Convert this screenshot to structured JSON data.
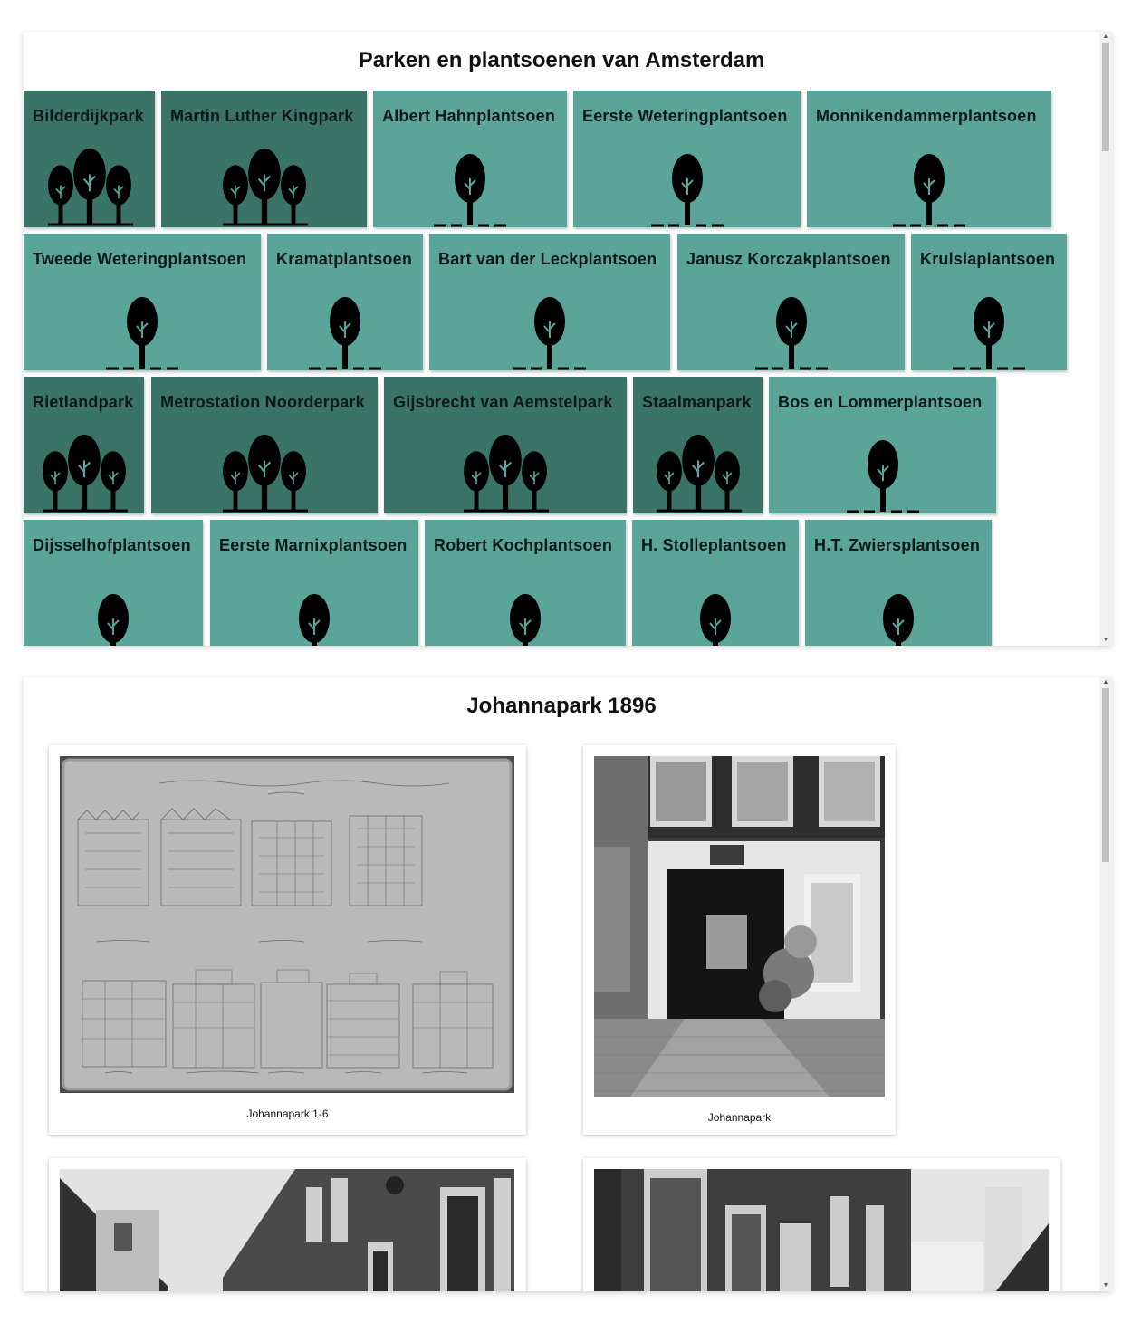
{
  "parks_panel": {
    "title": "Parken en plantsoenen van Amsterdam",
    "tiles": [
      {
        "name": "Bilderdijkpark",
        "kind": "park"
      },
      {
        "name": "Martin Luther Kingpark",
        "kind": "park"
      },
      {
        "name": "Albert Hahnplantsoen",
        "kind": "plantsoen"
      },
      {
        "name": "Eerste Weteringplantsoen",
        "kind": "plantsoen"
      },
      {
        "name": "Monnikendammerplantsoen",
        "kind": "plantsoen"
      },
      {
        "name": "Tweede Weteringplantsoen",
        "kind": "plantsoen"
      },
      {
        "name": "Kramatplantsoen",
        "kind": "plantsoen"
      },
      {
        "name": "Bart van der Leckplantsoen",
        "kind": "plantsoen"
      },
      {
        "name": "Janusz Korczakplantsoen",
        "kind": "plantsoen"
      },
      {
        "name": "Krulslaplantsoen",
        "kind": "plantsoen"
      },
      {
        "name": "Rietlandpark",
        "kind": "park"
      },
      {
        "name": "Metrostation Noorderpark",
        "kind": "park"
      },
      {
        "name": "Gijsbrecht van Aemstelpark",
        "kind": "park"
      },
      {
        "name": "Staalmanpark",
        "kind": "park"
      },
      {
        "name": "Bos en Lommerplantsoen",
        "kind": "plantsoen"
      },
      {
        "name": "Dijsselhofplantsoen",
        "kind": "plantsoen"
      },
      {
        "name": "Eerste Marnixplantsoen",
        "kind": "plantsoen"
      },
      {
        "name": "Robert Kochplantsoen",
        "kind": "plantsoen"
      },
      {
        "name": "H. Stolleplantsoen",
        "kind": "plantsoen"
      },
      {
        "name": "H.T. Zwiersplantsoen",
        "kind": "plantsoen"
      }
    ]
  },
  "detail_panel": {
    "title": "Johannapark 1896",
    "photos": [
      {
        "caption": "Johannapark 1-6",
        "kind": "drawing"
      },
      {
        "caption": "Johannapark",
        "kind": "gateway-photo"
      },
      {
        "caption": "",
        "kind": "street-photo"
      },
      {
        "caption": "",
        "kind": "street-photo"
      }
    ]
  },
  "colors": {
    "park_tile": "#3a7466",
    "plantsoen_tile": "#5aa499",
    "tree": "#000000",
    "tree_detail": "#5aa499"
  },
  "icons": {
    "park": "three-trees-icon",
    "plantsoen": "single-tree-icon"
  }
}
